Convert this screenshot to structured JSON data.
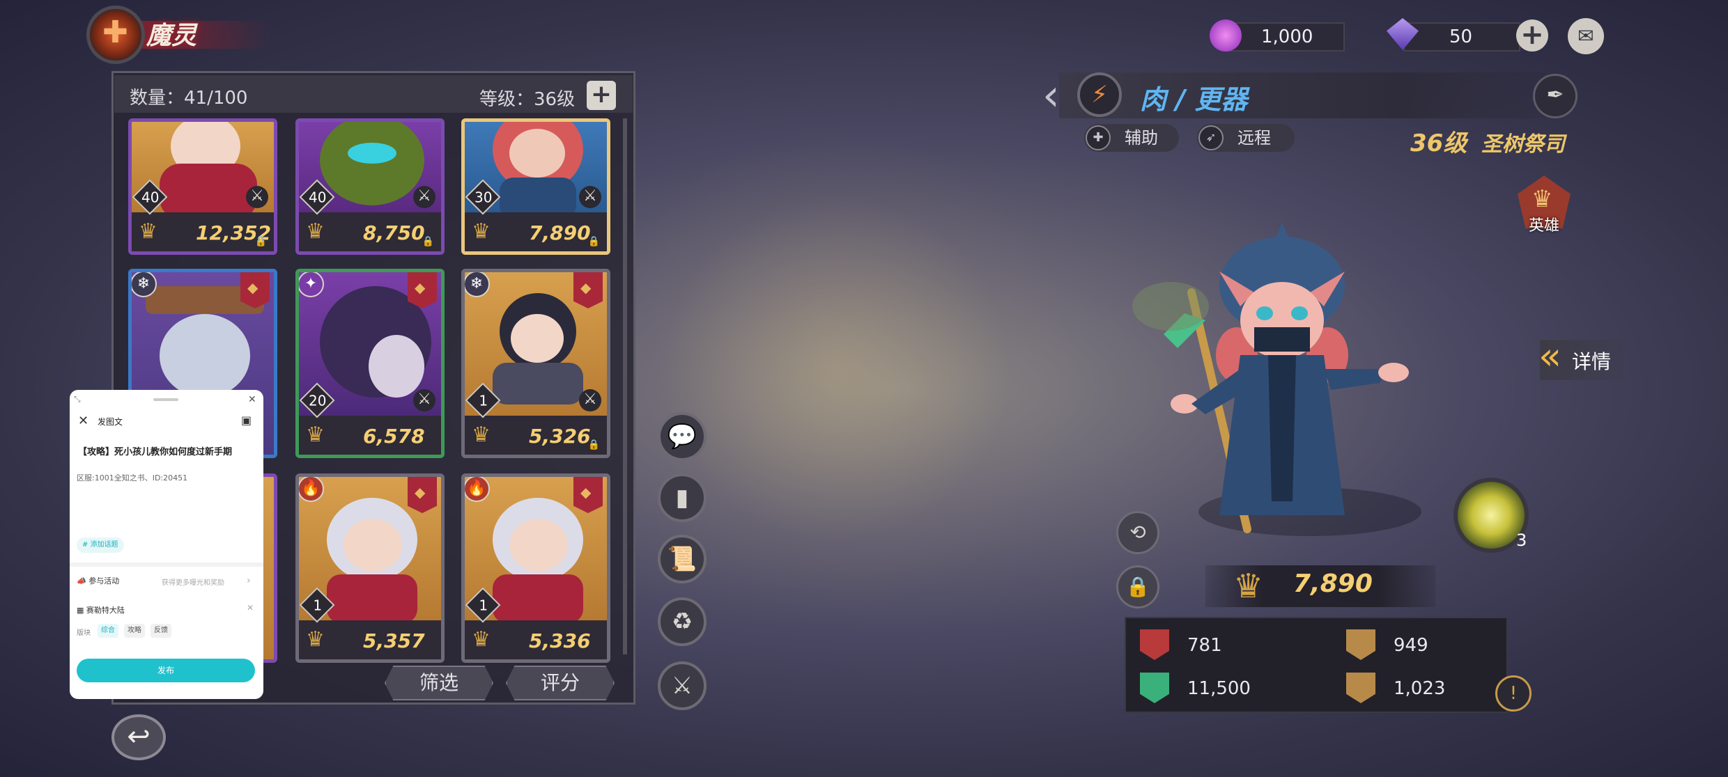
{
  "header": {
    "title": "魔灵"
  },
  "inventory": {
    "count_text": "数量：41/100",
    "level_text": "等级：36级",
    "plus": "+",
    "filter_label": "筛选",
    "rate_label": "评分"
  },
  "cards": [
    {
      "level": "40",
      "power": "12,352",
      "border": "purple"
    },
    {
      "level": "40",
      "power": "8,750",
      "border": "purple"
    },
    {
      "level": "30",
      "power": "7,890",
      "border": "gold"
    },
    {
      "level": "",
      "power": "",
      "border": "blue"
    },
    {
      "level": "20",
      "power": "6,578",
      "border": "green"
    },
    {
      "level": "1",
      "power": "5,326",
      "border": "grey"
    },
    {
      "level": "",
      "power": "",
      "border": "purple"
    },
    {
      "level": "1",
      "power": "5,357",
      "border": "grey"
    },
    {
      "level": "1",
      "power": "5,336",
      "border": "grey"
    }
  ],
  "resources": {
    "soul": "1,000",
    "crystal": "50",
    "plus": "+"
  },
  "hero": {
    "name": "肉 / 更器",
    "tag1": "辅助",
    "tag2": "远程",
    "level": "36级",
    "title": "圣树祭司",
    "badge": "英雄",
    "detail": "详情",
    "power": "7,890",
    "skill_count": "3",
    "stats": {
      "attack": "781",
      "defense": "949",
      "hp": "11,500",
      "speed": "1,023"
    }
  },
  "popup": {
    "header": "发图文",
    "title": "【攻略】死小孩儿教你如何度过新手期",
    "body": "区服:1001全知之书、ID:20451",
    "topic": "# 添加话题",
    "activity": "参与活动",
    "activity_hint": "获得更多曝光和奖励",
    "game": "赛勒特大陆",
    "section_label": "版块",
    "chips": [
      "综合",
      "攻略",
      "反馈"
    ],
    "publish": "发布"
  },
  "colors": {
    "accent_gold": "#f5cf73",
    "hero_name_blue": "#5fb6f3",
    "publish_teal": "#1fc2cc"
  }
}
